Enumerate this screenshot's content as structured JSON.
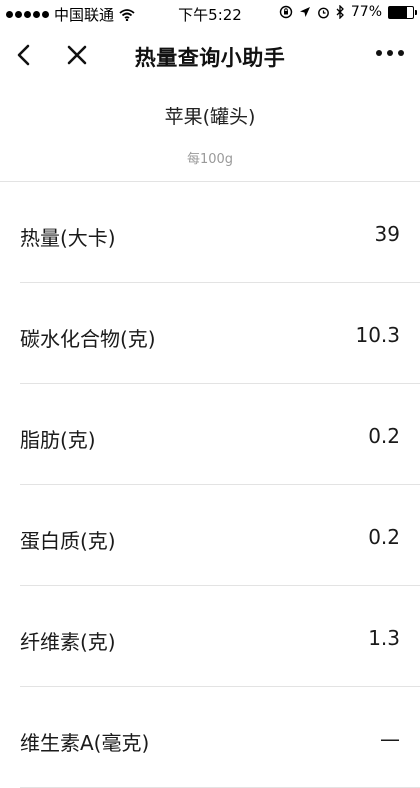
{
  "status_bar": {
    "carrier": "中国联通",
    "time": "下午5:22",
    "battery_percent": "77%",
    "battery_level": 0.77
  },
  "nav": {
    "title": "热量查询小助手"
  },
  "food": {
    "name": "苹果(罐头)",
    "per_unit": "每100g"
  },
  "nutrients": [
    {
      "label": "热量(大卡)",
      "value": "39"
    },
    {
      "label": "碳水化合物(克)",
      "value": "10.3"
    },
    {
      "label": "脂肪(克)",
      "value": "0.2"
    },
    {
      "label": "蛋白质(克)",
      "value": "0.2"
    },
    {
      "label": "纤维素(克)",
      "value": "1.3"
    },
    {
      "label": "维生素A(毫克)",
      "value": "—"
    }
  ]
}
